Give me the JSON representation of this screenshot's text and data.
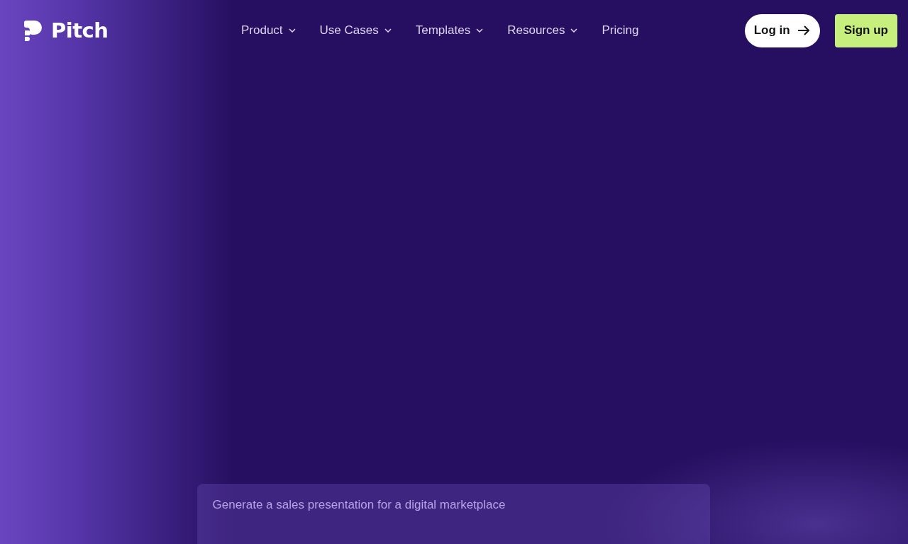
{
  "header": {
    "logo": "Pitch",
    "nav": [
      {
        "label": "Product",
        "dropdown": true
      },
      {
        "label": "Use Cases",
        "dropdown": true
      },
      {
        "label": "Templates",
        "dropdown": true
      },
      {
        "label": "Resources",
        "dropdown": true
      },
      {
        "label": "Pricing",
        "dropdown": false
      }
    ],
    "login": "Log in",
    "signup": "Sign up"
  },
  "prompt": {
    "placeholder": "Generate a sales presentation for a digital marketplace"
  }
}
